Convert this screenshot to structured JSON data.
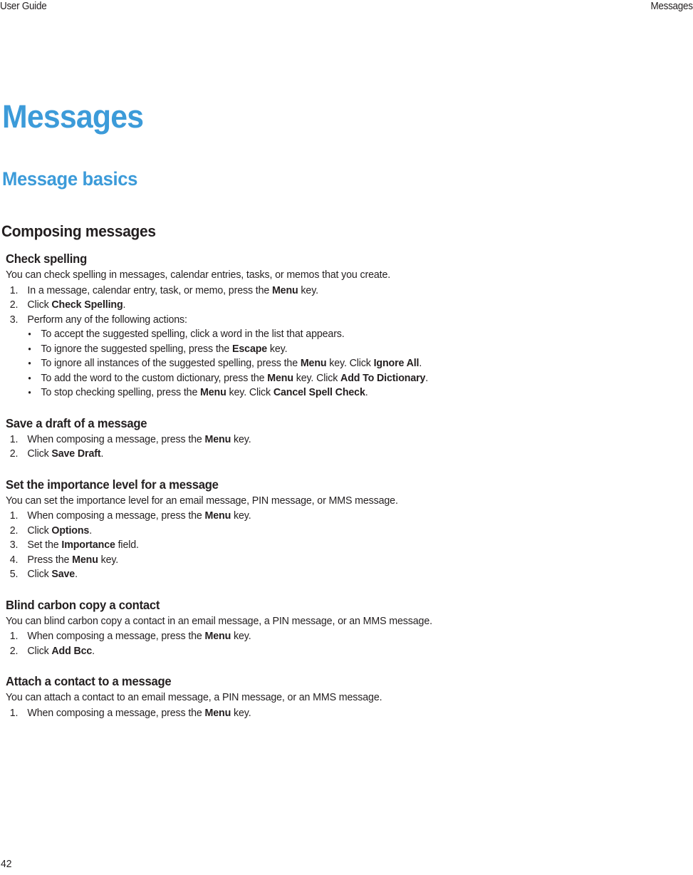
{
  "header": {
    "left": "User Guide",
    "right": "Messages"
  },
  "title": "Messages",
  "subtitle": "Message basics",
  "section_heading": "Composing messages",
  "footer": {
    "page_number": "42"
  },
  "colors": {
    "heading_blue": "#3c9bd9",
    "body_text": "#231f20",
    "page_background": "#ffffff"
  },
  "sections": [
    {
      "heading": "Check spelling",
      "intro": "You can check spelling in messages, calendar entries, tasks, or memos that you create.",
      "steps": [
        {
          "num": "1.",
          "html": "In a message, calendar entry, task, or memo, press the <b>Menu</b> key."
        },
        {
          "num": "2.",
          "html": "Click <b>Check Spelling</b>."
        },
        {
          "num": "3.",
          "html": "Perform any of the following actions:"
        }
      ],
      "bullets": [
        {
          "dot": "•",
          "html": "To accept the suggested spelling, click a word in the list that appears."
        },
        {
          "dot": "•",
          "html": "To ignore the suggested spelling, press the <b>Escape</b> key."
        },
        {
          "dot": "•",
          "html": "To ignore all instances of the suggested spelling, press the <b>Menu</b> key. Click <b>Ignore All</b>."
        },
        {
          "dot": "•",
          "html": "To add the word to the custom dictionary, press the <b>Menu</b> key. Click <b>Add To Dictionary</b>."
        },
        {
          "dot": "•",
          "html": "To stop checking spelling, press the <b>Menu</b> key. Click <b>Cancel Spell Check</b>."
        }
      ]
    },
    {
      "heading": "Save a draft of a message",
      "intro": "",
      "steps": [
        {
          "num": "1.",
          "html": "When composing a message, press the <b>Menu</b> key."
        },
        {
          "num": "2.",
          "html": "Click <b>Save Draft</b>."
        }
      ],
      "bullets": []
    },
    {
      "heading": "Set the importance level for a message",
      "intro": "You can set the importance level for an email message, PIN message, or MMS message.",
      "steps": [
        {
          "num": "1.",
          "html": "When composing a message, press the <b>Menu</b> key."
        },
        {
          "num": "2.",
          "html": "Click <b>Options</b>."
        },
        {
          "num": "3.",
          "html": "Set the <b>Importance</b> field."
        },
        {
          "num": "4.",
          "html": "Press the <b>Menu</b> key."
        },
        {
          "num": "5.",
          "html": "Click <b>Save</b>."
        }
      ],
      "bullets": []
    },
    {
      "heading": "Blind carbon copy a contact",
      "intro": "You can blind carbon copy a contact in an email message, a PIN message, or an MMS message.",
      "steps": [
        {
          "num": "1.",
          "html": "When composing a message, press the <b>Menu</b> key."
        },
        {
          "num": "2.",
          "html": "Click <b>Add Bcc</b>."
        }
      ],
      "bullets": []
    },
    {
      "heading": "Attach a contact to a message",
      "intro": "You can attach a contact to an email message, a PIN message, or an MMS message.",
      "steps": [
        {
          "num": "1.",
          "html": "When composing a message, press the <b>Menu</b> key."
        }
      ],
      "bullets": []
    }
  ]
}
